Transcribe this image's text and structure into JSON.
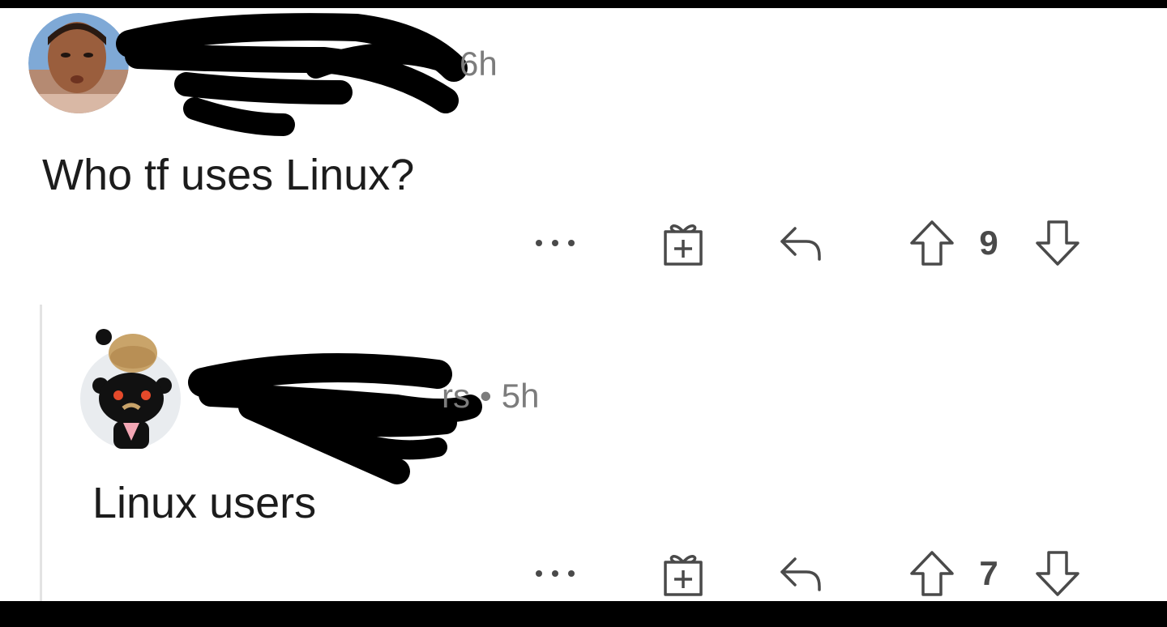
{
  "comments": [
    {
      "time": "6h",
      "text": "Who tf uses Linux?",
      "vote_count": "9",
      "icons": [
        "more-icon",
        "award-icon",
        "reply-icon",
        "upvote-icon",
        "downvote-icon"
      ]
    },
    {
      "username_fragment": "rs",
      "separator": "•",
      "time": "5h",
      "text": "Linux users",
      "vote_count": "7",
      "icons": [
        "more-icon",
        "award-icon",
        "reply-icon",
        "upvote-icon",
        "downvote-icon"
      ]
    }
  ],
  "colors": {
    "text": "#1c1c1c",
    "meta": "#7c7c7c",
    "icon": "#4a4a4a",
    "thread_line": "#e3e3e3"
  }
}
